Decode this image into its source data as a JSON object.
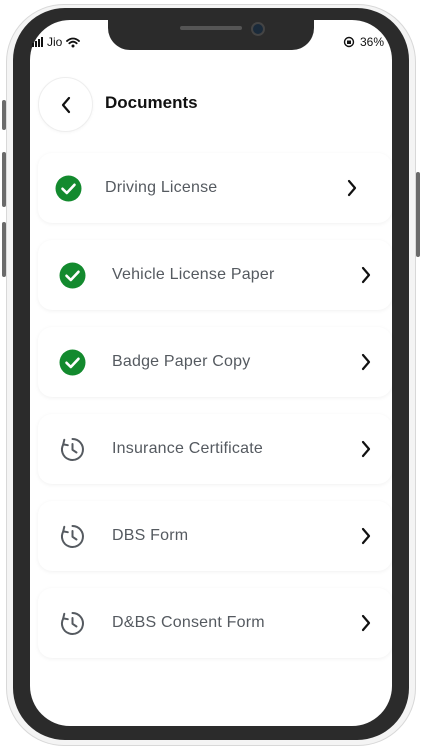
{
  "status_bar": {
    "carrier": "Jio",
    "battery": "36%"
  },
  "header": {
    "title": "Documents"
  },
  "colors": {
    "verified": "#138a2e",
    "pending_icon": "#555a60",
    "label": "#555a60"
  },
  "documents": [
    {
      "label": "Driving License",
      "status": "verified",
      "icon": "check-circle-icon"
    },
    {
      "label": "Vehicle License Paper",
      "status": "verified",
      "icon": "check-circle-icon"
    },
    {
      "label": "Badge Paper Copy",
      "status": "verified",
      "icon": "check-circle-icon"
    },
    {
      "label": "Insurance Certificate",
      "status": "pending",
      "icon": "clock-icon"
    },
    {
      "label": "DBS Form",
      "status": "pending",
      "icon": "clock-icon"
    },
    {
      "label": "D&BS Consent Form",
      "status": "pending",
      "icon": "clock-icon"
    }
  ]
}
